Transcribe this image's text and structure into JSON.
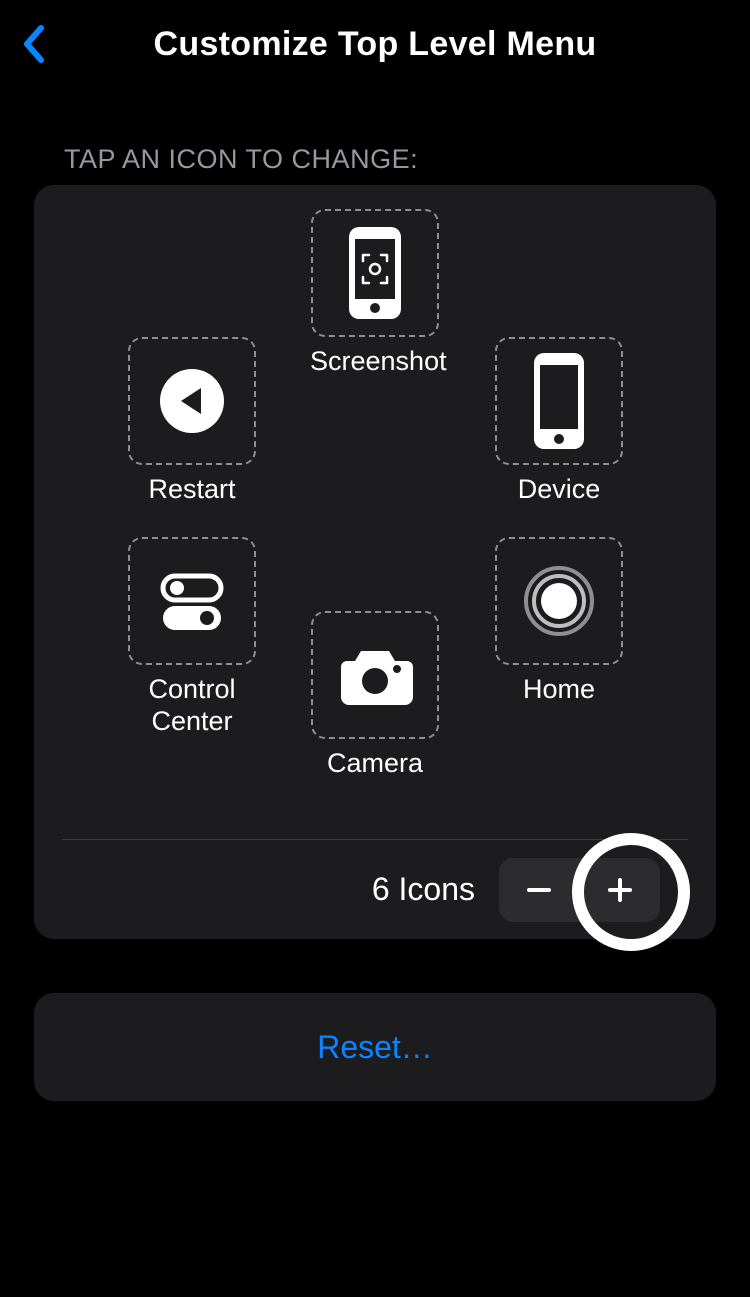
{
  "header": {
    "title": "Customize Top Level Menu"
  },
  "section": {
    "label": "TAP AN ICON TO CHANGE:"
  },
  "menu": {
    "items": {
      "top": {
        "label": "Screenshot",
        "icon": "screenshot-icon"
      },
      "left1": {
        "label": "Restart",
        "icon": "restart-icon"
      },
      "right1": {
        "label": "Device",
        "icon": "device-icon"
      },
      "left2": {
        "label": "Control\nCenter",
        "icon": "control-center-icon"
      },
      "right2": {
        "label": "Home",
        "icon": "home-icon"
      },
      "bottom": {
        "label": "Camera",
        "icon": "camera-icon"
      }
    }
  },
  "footer": {
    "count_label": "6 Icons",
    "minus": "–",
    "plus": "+"
  },
  "reset": {
    "label": "Reset…"
  }
}
